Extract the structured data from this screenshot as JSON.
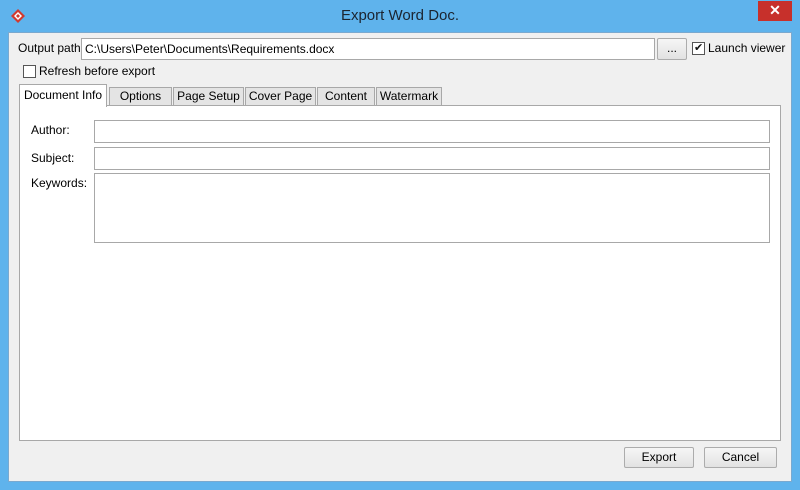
{
  "window": {
    "title": "Export Word Doc.",
    "close_glyph": "✕",
    "app_icon": "visual-paradigm-icon"
  },
  "output": {
    "label": "Output path:",
    "value": "C:\\Users\\Peter\\Documents\\Requirements.docx",
    "browse_label": "...",
    "launch_viewer_label": "Launch viewer",
    "launch_viewer_checked": true
  },
  "refresh": {
    "label": "Refresh before export",
    "checked": false
  },
  "tabs": [
    {
      "label": "Document Info",
      "active": true
    },
    {
      "label": "Options"
    },
    {
      "label": "Page Setup"
    },
    {
      "label": "Cover Page"
    },
    {
      "label": "Content"
    },
    {
      "label": "Watermark"
    }
  ],
  "doc_info": {
    "author_label": "Author:",
    "author_value": "",
    "subject_label": "Subject:",
    "subject_value": "",
    "keywords_label": "Keywords:",
    "keywords_value": ""
  },
  "buttons": {
    "export": "Export",
    "cancel": "Cancel"
  },
  "colors": {
    "title_bar": "#5fb3ec",
    "close_button": "#c7302b"
  }
}
